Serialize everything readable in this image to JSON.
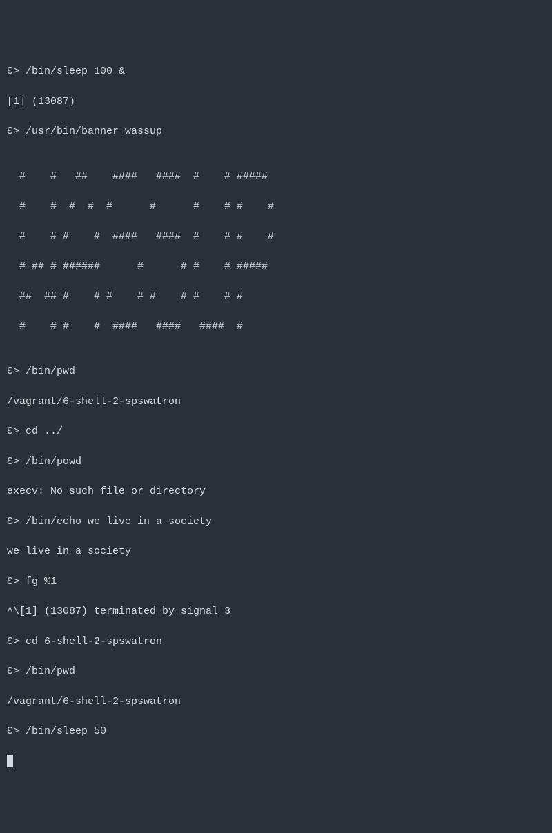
{
  "prompt": "Ɛ> ",
  "lines": {
    "l0": "Ɛ> /bin/sleep 100 &",
    "l1": "[1] (13087)",
    "l2": "Ɛ> /usr/bin/banner wassup",
    "l3": "",
    "l4": "  #    #   ##    ####   ####  #    # #####",
    "l5": "  #    #  #  #  #      #      #    # #    #",
    "l6": "  #    # #    #  ####   ####  #    # #    #",
    "l7": "  # ## # ######      #      # #    # #####",
    "l8": "  ##  ## #    # #    # #    # #    # #",
    "l9": "  #    # #    #  ####   ####   ####  #",
    "l10": "",
    "l11": "Ɛ> /bin/pwd",
    "l12": "/vagrant/6-shell-2-spswatron",
    "l13": "Ɛ> cd ../",
    "l14": "Ɛ> /bin/powd",
    "l15": "execv: No such file or directory",
    "l16": "Ɛ> /bin/echo we live in a society",
    "l17": "we live in a society",
    "l18": "Ɛ> fg %1",
    "l19": "^\\[1] (13087) terminated by signal 3",
    "l20": "Ɛ> cd 6-shell-2-spswatron",
    "l21": "Ɛ> /bin/pwd",
    "l22": "/vagrant/6-shell-2-spswatron",
    "l23": "Ɛ> /bin/sleep 50"
  }
}
